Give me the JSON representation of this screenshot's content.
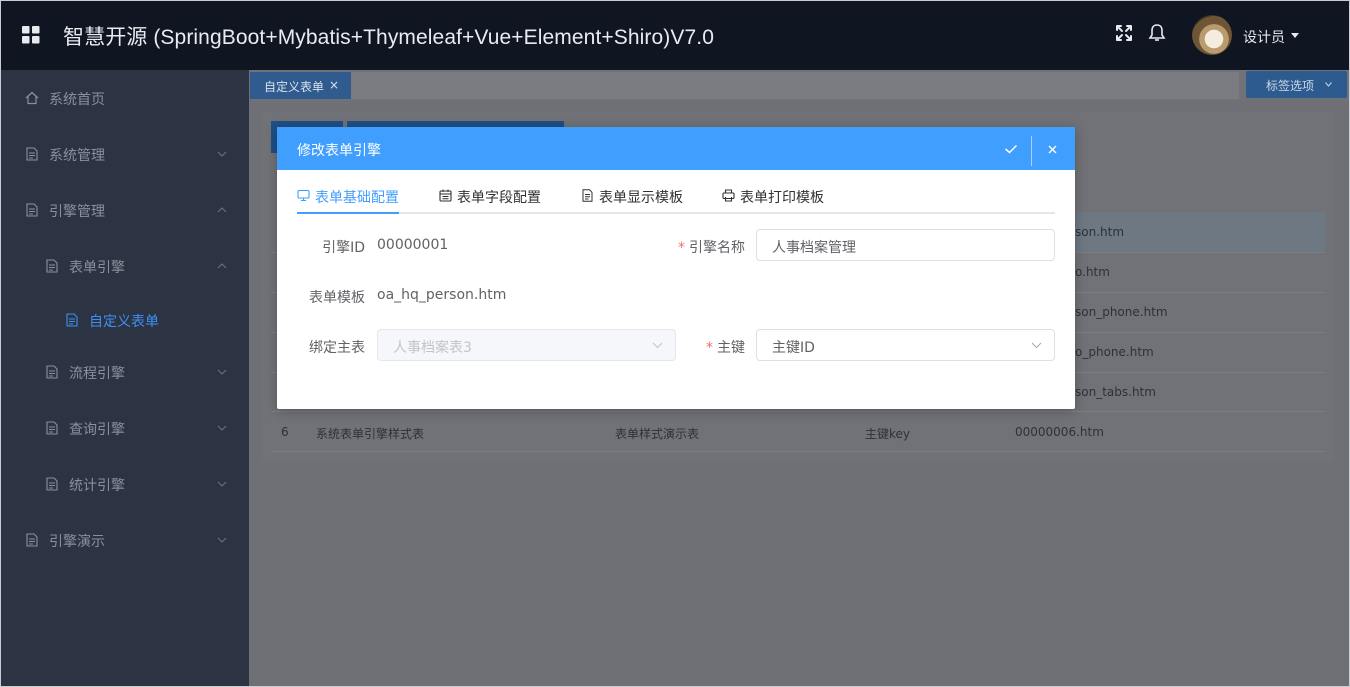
{
  "header": {
    "title": "智慧开源 (SpringBoot+Mybatis+Thymeleaf+Vue+Element+Shiro)V7.0",
    "user_name": "设计员",
    "icons": [
      "grid-icon",
      "fullscreen-icon",
      "bell-icon",
      "avatar",
      "chevron-down-icon"
    ]
  },
  "sidebar": {
    "items": [
      {
        "label": "系统首页",
        "icon": "home-icon"
      },
      {
        "label": "系统管理",
        "icon": "document-icon"
      },
      {
        "label": "引擎管理",
        "icon": "document-icon"
      },
      {
        "label": "表单引擎",
        "icon": "document-icon"
      },
      {
        "label": "自定义表单",
        "icon": "document-icon"
      },
      {
        "label": "流程引擎",
        "icon": "document-icon"
      },
      {
        "label": "查询引擎",
        "icon": "document-icon"
      },
      {
        "label": "统计引擎",
        "icon": "document-icon"
      },
      {
        "label": "引擎演示",
        "icon": "document-icon"
      }
    ]
  },
  "tabs": {
    "active_label": "自定义表单",
    "close_glyph": "×",
    "options_label": "标签选项"
  },
  "background_table": {
    "row6": {
      "index": "6",
      "name": "系统表单引擎样式表",
      "desc": "表单样式演示表",
      "key": "主键key",
      "file": "00000006.htm"
    },
    "visible_file_fragments": [
      "son.htm",
      "o.htm",
      "son_phone.htm",
      "o_phone.htm",
      "son_tabs.htm"
    ]
  },
  "dialog": {
    "title": "修改表单引擎",
    "tabs": [
      {
        "label": "表单基础配置",
        "icon": "monitor-icon"
      },
      {
        "label": "表单字段配置",
        "icon": "calendar-icon"
      },
      {
        "label": "表单显示模板",
        "icon": "document-icon"
      },
      {
        "label": "表单打印模板",
        "icon": "printer-icon"
      }
    ],
    "fields": {
      "engine_id_label": "引擎ID",
      "engine_id_value": "00000001",
      "engine_name_label": "引擎名称",
      "engine_name_value": "人事档案管理",
      "template_label": "表单模板",
      "template_value": "oa_hq_person.htm",
      "bind_table_label": "绑定主表",
      "bind_table_value": "人事档案表3",
      "primary_key_label": "主键",
      "primary_key_value": "主键ID"
    },
    "required_mark": "*"
  },
  "colors": {
    "header_bg": "#0f1521",
    "sidebar_bg": "#2c3444",
    "accent": "#409eff",
    "sidebar_active": "#3e8ff0",
    "required": "#f56c6c"
  }
}
